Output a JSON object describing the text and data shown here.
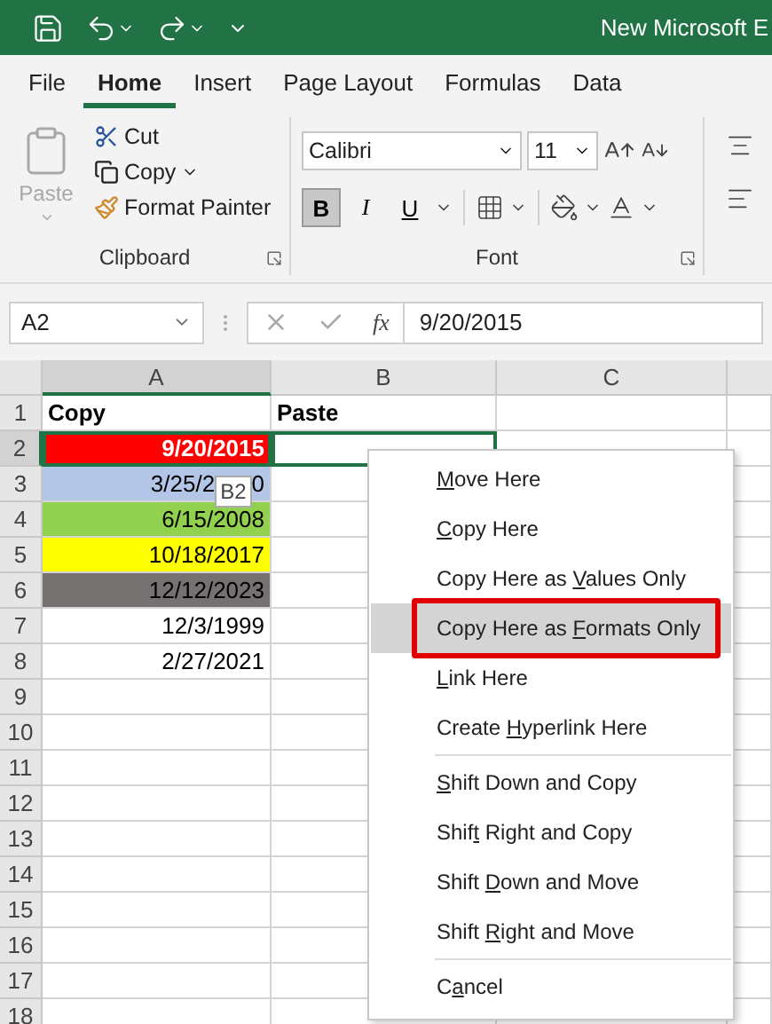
{
  "title_bar": {
    "title": "New Microsoft E"
  },
  "tabs": [
    {
      "label": "File",
      "selected": false
    },
    {
      "label": "Home",
      "selected": true
    },
    {
      "label": "Insert",
      "selected": false
    },
    {
      "label": "Page Layout",
      "selected": false
    },
    {
      "label": "Formulas",
      "selected": false
    },
    {
      "label": "Data",
      "selected": false
    }
  ],
  "ribbon": {
    "clipboard": {
      "paste": "Paste",
      "paste_disabled": true,
      "cut": "Cut",
      "copy": "Copy",
      "format_painter": "Format Painter",
      "label": "Clipboard"
    },
    "font": {
      "font_name": "Calibri",
      "font_size": "11",
      "styles": [
        {
          "label": "B",
          "kind": "bold",
          "selected": true
        },
        {
          "label": "I",
          "kind": "italic",
          "selected": false
        },
        {
          "label": "U",
          "kind": "underline",
          "selected": false
        }
      ],
      "label": "Font"
    }
  },
  "formula_bar": {
    "name_box": "A2",
    "fx": "fx",
    "formula": "9/20/2015"
  },
  "sheet": {
    "columns": [
      {
        "label": "A",
        "selected": true
      },
      {
        "label": "B",
        "selected": false
      },
      {
        "label": "C",
        "selected": false
      }
    ],
    "rows": [
      {
        "number": "1",
        "selected": false,
        "cells": [
          {
            "text": "Copy",
            "bold": true,
            "selected": false
          },
          {
            "text": "Paste",
            "bold": true,
            "selected": false
          }
        ]
      },
      {
        "number": "2",
        "selected": true,
        "cells": [
          {
            "text": "9/20/2015",
            "bold": true,
            "color": "#ff0000",
            "light_text": true,
            "selected": true
          },
          {
            "selected": true
          }
        ]
      },
      {
        "number": "3",
        "selected": false,
        "cells": [
          {
            "text": "3/25/2",
            "text_after": "0",
            "tooltip": "B2",
            "color": "#b4c6e7",
            "selected": false
          }
        ]
      },
      {
        "number": "4",
        "selected": false,
        "cells": [
          {
            "text": "6/15/2008",
            "color": "#92d050",
            "selected": false
          }
        ]
      },
      {
        "number": "5",
        "selected": false,
        "cells": [
          {
            "text": "10/18/2017",
            "color": "#ffff00",
            "selected": false
          }
        ]
      },
      {
        "number": "6",
        "selected": false,
        "cells": [
          {
            "text": "12/12/2023",
            "color": "#767171",
            "selected": false
          }
        ]
      },
      {
        "number": "7",
        "selected": false,
        "cells": [
          {
            "text": "12/3/1999",
            "selected": false
          }
        ]
      },
      {
        "number": "8",
        "selected": false,
        "cells": [
          {
            "text": "2/27/2021",
            "selected": false
          }
        ]
      },
      {
        "number": "9",
        "selected": false
      },
      {
        "number": "10",
        "selected": false
      },
      {
        "number": "11",
        "selected": false
      },
      {
        "number": "12",
        "selected": false
      },
      {
        "number": "13",
        "selected": false
      },
      {
        "number": "14",
        "selected": false
      },
      {
        "number": "15",
        "selected": false
      },
      {
        "number": "16",
        "selected": false
      },
      {
        "number": "17",
        "selected": false
      },
      {
        "number": "18",
        "selected": false
      }
    ]
  },
  "context_menu": {
    "groups": [
      [
        {
          "key": "M",
          "after": "ove Here",
          "selected": false,
          "highlighted": false
        },
        {
          "key": "C",
          "after": "opy Here",
          "selected": false,
          "highlighted": false
        },
        {
          "before": "Copy Here as ",
          "key": "V",
          "after": "alues Only",
          "selected": false,
          "highlighted": false
        },
        {
          "before": "Copy Here as ",
          "key": "F",
          "after": "ormats Only",
          "selected": true,
          "highlighted": true
        },
        {
          "key": "L",
          "after": "ink Here",
          "selected": false,
          "highlighted": false
        },
        {
          "before": "Create ",
          "key": "H",
          "after": "yperlink Here",
          "selected": false,
          "highlighted": false
        }
      ],
      [
        {
          "key": "S",
          "after": "hift Down and Copy",
          "selected": false,
          "highlighted": false
        },
        {
          "before": "Shif",
          "key": "t",
          "after": " Right and Copy",
          "selected": false,
          "highlighted": false
        },
        {
          "before": "Shift ",
          "key": "D",
          "after": "own and Move",
          "selected": false,
          "highlighted": false
        },
        {
          "before": "Shift ",
          "key": "R",
          "after": "ight and Move",
          "selected": false,
          "highlighted": false
        }
      ],
      [
        {
          "before": "C",
          "key": "a",
          "after": "ncel",
          "selected": false,
          "highlighted": false
        }
      ]
    ]
  }
}
